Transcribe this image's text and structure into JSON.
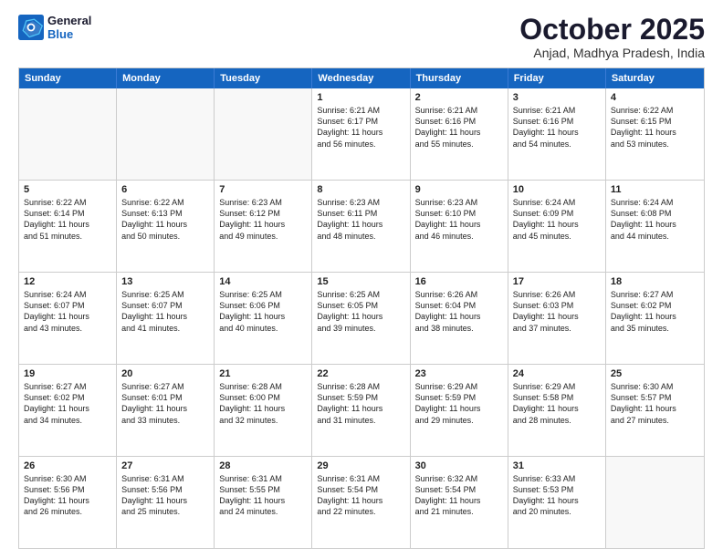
{
  "logo": {
    "line1": "General",
    "line2": "Blue"
  },
  "header": {
    "month": "October 2025",
    "location": "Anjad, Madhya Pradesh, India"
  },
  "dayHeaders": [
    "Sunday",
    "Monday",
    "Tuesday",
    "Wednesday",
    "Thursday",
    "Friday",
    "Saturday"
  ],
  "weeks": [
    [
      {
        "date": "",
        "info": ""
      },
      {
        "date": "",
        "info": ""
      },
      {
        "date": "",
        "info": ""
      },
      {
        "date": "1",
        "info": "Sunrise: 6:21 AM\nSunset: 6:17 PM\nDaylight: 11 hours\nand 56 minutes."
      },
      {
        "date": "2",
        "info": "Sunrise: 6:21 AM\nSunset: 6:16 PM\nDaylight: 11 hours\nand 55 minutes."
      },
      {
        "date": "3",
        "info": "Sunrise: 6:21 AM\nSunset: 6:16 PM\nDaylight: 11 hours\nand 54 minutes."
      },
      {
        "date": "4",
        "info": "Sunrise: 6:22 AM\nSunset: 6:15 PM\nDaylight: 11 hours\nand 53 minutes."
      }
    ],
    [
      {
        "date": "5",
        "info": "Sunrise: 6:22 AM\nSunset: 6:14 PM\nDaylight: 11 hours\nand 51 minutes."
      },
      {
        "date": "6",
        "info": "Sunrise: 6:22 AM\nSunset: 6:13 PM\nDaylight: 11 hours\nand 50 minutes."
      },
      {
        "date": "7",
        "info": "Sunrise: 6:23 AM\nSunset: 6:12 PM\nDaylight: 11 hours\nand 49 minutes."
      },
      {
        "date": "8",
        "info": "Sunrise: 6:23 AM\nSunset: 6:11 PM\nDaylight: 11 hours\nand 48 minutes."
      },
      {
        "date": "9",
        "info": "Sunrise: 6:23 AM\nSunset: 6:10 PM\nDaylight: 11 hours\nand 46 minutes."
      },
      {
        "date": "10",
        "info": "Sunrise: 6:24 AM\nSunset: 6:09 PM\nDaylight: 11 hours\nand 45 minutes."
      },
      {
        "date": "11",
        "info": "Sunrise: 6:24 AM\nSunset: 6:08 PM\nDaylight: 11 hours\nand 44 minutes."
      }
    ],
    [
      {
        "date": "12",
        "info": "Sunrise: 6:24 AM\nSunset: 6:07 PM\nDaylight: 11 hours\nand 43 minutes."
      },
      {
        "date": "13",
        "info": "Sunrise: 6:25 AM\nSunset: 6:07 PM\nDaylight: 11 hours\nand 41 minutes."
      },
      {
        "date": "14",
        "info": "Sunrise: 6:25 AM\nSunset: 6:06 PM\nDaylight: 11 hours\nand 40 minutes."
      },
      {
        "date": "15",
        "info": "Sunrise: 6:25 AM\nSunset: 6:05 PM\nDaylight: 11 hours\nand 39 minutes."
      },
      {
        "date": "16",
        "info": "Sunrise: 6:26 AM\nSunset: 6:04 PM\nDaylight: 11 hours\nand 38 minutes."
      },
      {
        "date": "17",
        "info": "Sunrise: 6:26 AM\nSunset: 6:03 PM\nDaylight: 11 hours\nand 37 minutes."
      },
      {
        "date": "18",
        "info": "Sunrise: 6:27 AM\nSunset: 6:02 PM\nDaylight: 11 hours\nand 35 minutes."
      }
    ],
    [
      {
        "date": "19",
        "info": "Sunrise: 6:27 AM\nSunset: 6:02 PM\nDaylight: 11 hours\nand 34 minutes."
      },
      {
        "date": "20",
        "info": "Sunrise: 6:27 AM\nSunset: 6:01 PM\nDaylight: 11 hours\nand 33 minutes."
      },
      {
        "date": "21",
        "info": "Sunrise: 6:28 AM\nSunset: 6:00 PM\nDaylight: 11 hours\nand 32 minutes."
      },
      {
        "date": "22",
        "info": "Sunrise: 6:28 AM\nSunset: 5:59 PM\nDaylight: 11 hours\nand 31 minutes."
      },
      {
        "date": "23",
        "info": "Sunrise: 6:29 AM\nSunset: 5:59 PM\nDaylight: 11 hours\nand 29 minutes."
      },
      {
        "date": "24",
        "info": "Sunrise: 6:29 AM\nSunset: 5:58 PM\nDaylight: 11 hours\nand 28 minutes."
      },
      {
        "date": "25",
        "info": "Sunrise: 6:30 AM\nSunset: 5:57 PM\nDaylight: 11 hours\nand 27 minutes."
      }
    ],
    [
      {
        "date": "26",
        "info": "Sunrise: 6:30 AM\nSunset: 5:56 PM\nDaylight: 11 hours\nand 26 minutes."
      },
      {
        "date": "27",
        "info": "Sunrise: 6:31 AM\nSunset: 5:56 PM\nDaylight: 11 hours\nand 25 minutes."
      },
      {
        "date": "28",
        "info": "Sunrise: 6:31 AM\nSunset: 5:55 PM\nDaylight: 11 hours\nand 24 minutes."
      },
      {
        "date": "29",
        "info": "Sunrise: 6:31 AM\nSunset: 5:54 PM\nDaylight: 11 hours\nand 22 minutes."
      },
      {
        "date": "30",
        "info": "Sunrise: 6:32 AM\nSunset: 5:54 PM\nDaylight: 11 hours\nand 21 minutes."
      },
      {
        "date": "31",
        "info": "Sunrise: 6:33 AM\nSunset: 5:53 PM\nDaylight: 11 hours\nand 20 minutes."
      },
      {
        "date": "",
        "info": ""
      }
    ]
  ]
}
